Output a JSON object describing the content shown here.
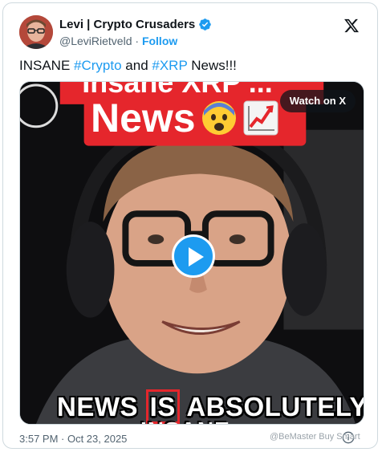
{
  "author": {
    "name": "Levi | Crypto Crusaders",
    "handle": "@LeviRietveld",
    "separator": " · ",
    "follow_label": "Follow"
  },
  "tweet": {
    "text_prefix": "INSANE ",
    "hashtag1": "#Crypto",
    "text_mid": " and ",
    "hashtag2": "#XRP",
    "text_suffix": " News!!!"
  },
  "media": {
    "watch_label": "Watch on X",
    "banner_top": "Insane XRP ...",
    "banner_main": "News",
    "caption_word1": "NEWS",
    "caption_highlight": "IS",
    "caption_word3": "ABSOLUTELY",
    "caption_sub": "INSANE"
  },
  "footer": {
    "timestamp": "3:57 PM · Oct 23, 2025"
  },
  "watermark": "@BeMaster Buy Smart",
  "icons": {
    "brand": "x-logo-icon",
    "verified": "verified-badge-icon",
    "play": "play-icon",
    "info": "info-icon",
    "emoji1": "fearful-face-icon",
    "emoji2": "chart-increasing-icon"
  },
  "colors": {
    "accent": "#1d9bf0",
    "banner_red": "#e5262c",
    "text": "#0f1419",
    "muted": "#536471"
  }
}
